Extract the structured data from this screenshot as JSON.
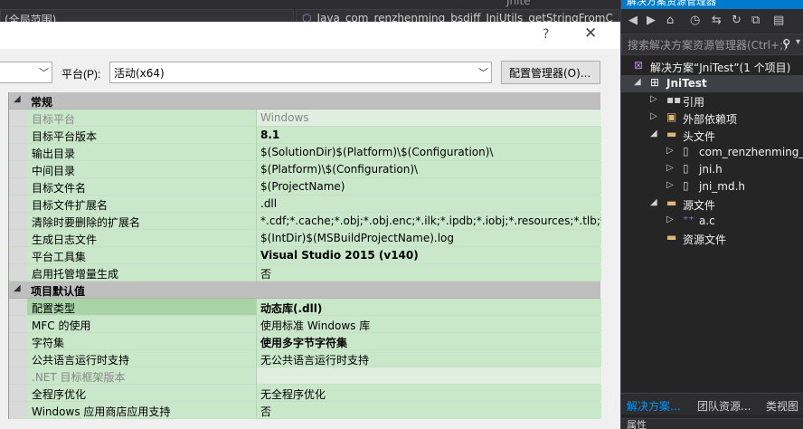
{
  "ide": {
    "crumb_left": "(全局范围)",
    "crumb_right": "Java_com_renzhenming_bsdiff_JniUtils_getStringFromC",
    "crumb_right_icon": "function-icon",
    "title_fragment": "Jnite"
  },
  "dialog": {
    "help": "?",
    "close": "✕",
    "platform_label": "平台(P):",
    "platform_value": "活动(x64)",
    "config_manager_label": "配置管理器(O)..."
  },
  "grid": {
    "sections": [
      {
        "label": "常规",
        "rows": [
          {
            "name": "目标平台",
            "value": "Windows",
            "dim": true
          },
          {
            "name": "目标平台版本",
            "value": "8.1",
            "bold": true
          },
          {
            "name": "输出目录",
            "value": "$(SolutionDir)$(Platform)\\$(Configuration)\\"
          },
          {
            "name": "中间目录",
            "value": "$(Platform)\\$(Configuration)\\"
          },
          {
            "name": "目标文件名",
            "value": "$(ProjectName)"
          },
          {
            "name": "目标文件扩展名",
            "value": ".dll"
          },
          {
            "name": "清除时要删除的扩展名",
            "value": "*.cdf;*.cache;*.obj;*.obj.enc;*.ilk;*.ipdb;*.iobj;*.resources;*.tlb;*.tli;*.t"
          },
          {
            "name": "生成日志文件",
            "value": "$(IntDir)$(MSBuildProjectName).log"
          },
          {
            "name": "平台工具集",
            "value": "Visual Studio 2015 (v140)",
            "bold": true
          },
          {
            "name": "启用托管增量生成",
            "value": "否"
          }
        ]
      },
      {
        "label": "项目默认值",
        "rows": [
          {
            "name": "配置类型",
            "value": "动态库(.dll)",
            "bold": true,
            "selected": true
          },
          {
            "name": "MFC 的使用",
            "value": "使用标准 Windows 库"
          },
          {
            "name": "字符集",
            "value": "使用多字节字符集",
            "bold": true
          },
          {
            "name": "公共语言运行时支持",
            "value": "无公共语言运行时支持"
          },
          {
            "name": ".NET 目标框架版本",
            "value": "",
            "dim": true
          },
          {
            "name": "全程序优化",
            "value": "无全程序优化"
          },
          {
            "name": "Windows 应用商店应用支持",
            "value": "否"
          }
        ]
      }
    ]
  },
  "solution_explorer": {
    "title": "解决方案资源管理器",
    "search_placeholder": "搜索解决方案资源管理器(Ctrl+;)",
    "tree": [
      {
        "label": "解决方案“JniTest”(1 个项目)",
        "icon": "solution-icon",
        "level": 0,
        "arrow": ""
      },
      {
        "label": "JniTest",
        "icon": "project-icon",
        "level": 1,
        "arrow": "◢",
        "bold": true,
        "selected": true
      },
      {
        "label": "引用",
        "icon": "references-icon",
        "level": 2,
        "arrow": "▷"
      },
      {
        "label": "外部依赖项",
        "icon": "external-deps-icon",
        "level": 2,
        "arrow": "▷"
      },
      {
        "label": "头文件",
        "icon": "folder-icon",
        "level": 2,
        "arrow": "◢"
      },
      {
        "label": "com_renzhenming_bsdiff_JniUtils.h",
        "icon": "header-file-icon",
        "level": 3,
        "arrow": "▷"
      },
      {
        "label": "jni.h",
        "icon": "header-file-icon",
        "level": 3,
        "arrow": "▷"
      },
      {
        "label": "jni_md.h",
        "icon": "header-file-icon",
        "level": 3,
        "arrow": "▷"
      },
      {
        "label": "源文件",
        "icon": "folder-icon",
        "level": 2,
        "arrow": "◢"
      },
      {
        "label": "a.c",
        "icon": "c-file-icon",
        "level": 3,
        "arrow": "▷"
      },
      {
        "label": "资源文件",
        "icon": "folder-icon",
        "level": 2,
        "arrow": ""
      }
    ],
    "tabs": [
      "解决方案...",
      "团队资源...",
      "类视图"
    ],
    "bottom_label": "属性"
  }
}
